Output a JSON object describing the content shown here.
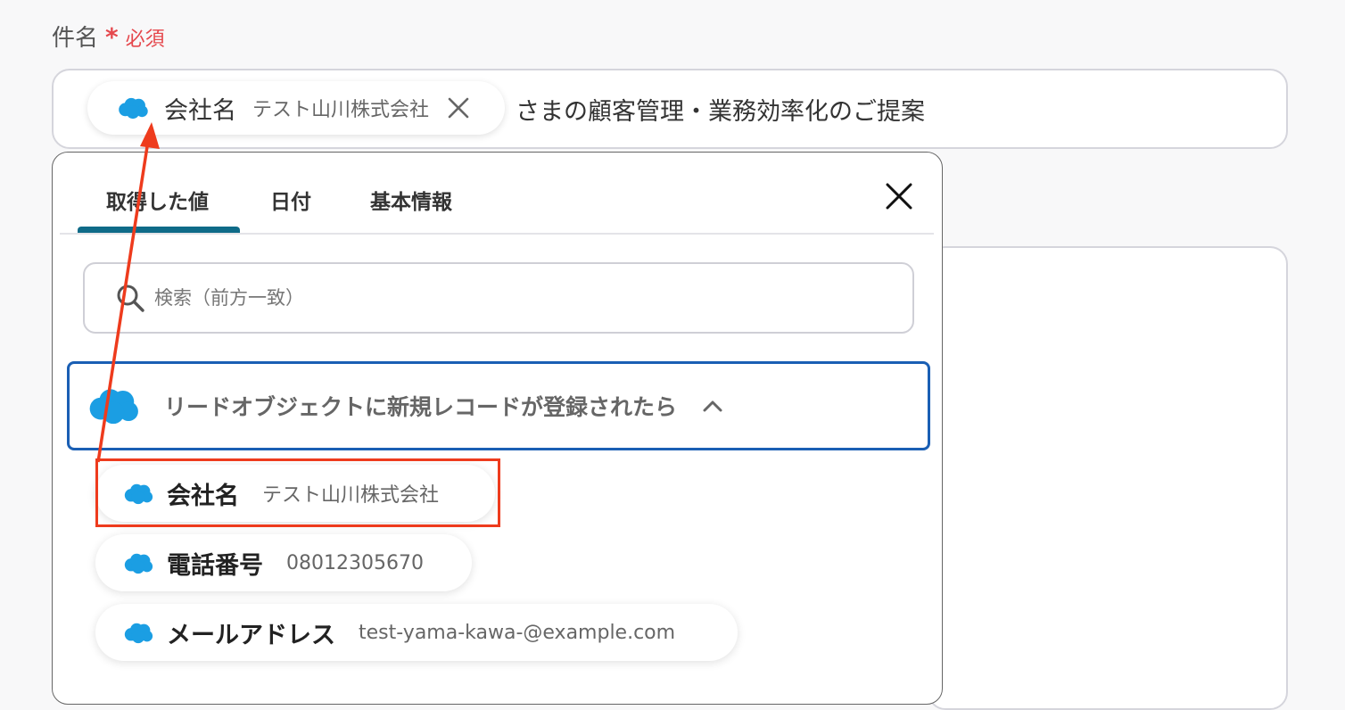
{
  "field": {
    "label": "件名",
    "required_star": "*",
    "required_text": "必須"
  },
  "token": {
    "name": "会社名",
    "value": "テスト山川株式会社",
    "close_icon": "close-icon"
  },
  "subject_suffix": "さまの顧客管理・業務効率化のご提案",
  "popup": {
    "tabs": [
      {
        "label": "取得した値",
        "active": true
      },
      {
        "label": "日付",
        "active": false
      },
      {
        "label": "基本情報",
        "active": false
      }
    ],
    "close_icon": "close-icon",
    "search": {
      "placeholder": "検索（前方一致）",
      "value": "",
      "icon": "search-icon"
    },
    "section": {
      "title": "リードオブジェクトに新規レコードが登録されたら",
      "icon": "salesforce-cloud-icon",
      "chevron": "chevron-up-icon"
    },
    "items": [
      {
        "name": "会社名",
        "value": "テスト山川株式会社"
      },
      {
        "name": "電話番号",
        "value": "08012305670"
      },
      {
        "name": "メールアドレス",
        "value": "test-yama-kawa-@example.com"
      }
    ]
  },
  "colors": {
    "salesforce_blue": "#1b9ee3",
    "tab_accent": "#0f6b88",
    "section_border": "#1a5fb4",
    "annotation_red": "#ee3b1d",
    "required_red": "#e5484d"
  }
}
